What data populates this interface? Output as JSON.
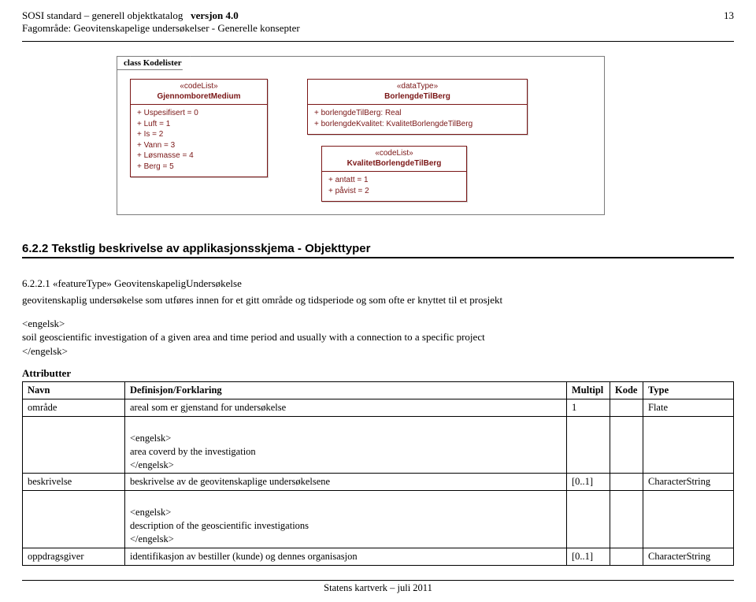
{
  "header": {
    "title_left": "SOSI standard – generell objektkatalog",
    "version_label": "versjon 4.0",
    "page_number": "13",
    "subtitle": "Fagområde: Geovitenskapelige undersøkelser -  Generelle konsepter"
  },
  "diagram": {
    "title": "class Kodelister",
    "box1": {
      "stereo": "«codeList»",
      "name": "GjennomboretMedium",
      "attrs": [
        "+    Uspesifisert = 0",
        "+    Luft = 1",
        "+    Is = 2",
        "+    Vann = 3",
        "+    Løsmasse = 4",
        "+    Berg = 5"
      ]
    },
    "box2": {
      "stereo": "«dataType»",
      "name": "BorlengdeTilBerg",
      "attrs": [
        "+    borlengdeTilBerg:  Real",
        "+    borlengdeKvalitet:  KvalitetBorlengdeTilBerg"
      ]
    },
    "box3": {
      "stereo": "«codeList»",
      "name": "KvalitetBorlengdeTilBerg",
      "attrs": [
        "+    antatt = 1",
        "+    påvist = 2"
      ]
    }
  },
  "section": {
    "heading": "6.2.2 Tekstlig beskrivelse av applikasjonsskjema - Objekttyper",
    "sub_number": "6.2.2.1",
    "sub_title": "«featureType» GeovitenskapeligUndersøkelse",
    "para_no": "geovitenskaplig undersøkelse som utføres innen for et gitt område og tidsperiode og som ofte er knyttet til et prosjekt",
    "engelsk_open": "<engelsk>",
    "para_en": "soil geoscientific investigation of a given area and time period and usually with a connection to a specific project",
    "engelsk_close": "</engelsk>",
    "attributter": "Attributter"
  },
  "table": {
    "headers": {
      "navn": "Navn",
      "def": "Definisjon/Forklaring",
      "mult": "Multipl",
      "kode": "Kode",
      "type": "Type"
    },
    "rows": [
      {
        "navn": "område",
        "def": "areal som er gjenstand for undersøkelse",
        "mult": "1",
        "kode": "",
        "type": "Flate",
        "extra": "<engelsk>\narea coverd by the investigation\n</engelsk>"
      },
      {
        "navn": "beskrivelse",
        "def": "beskrivelse av de geovitenskaplige undersøkelsene",
        "mult": "[0..1]",
        "kode": "",
        "type": "CharacterString",
        "extra": "<engelsk>\ndescription of the geoscientific investigations\n</engelsk>"
      },
      {
        "navn": "oppdragsgiver",
        "def": "identifikasjon av bestiller (kunde) og dennes organisasjon",
        "mult": "[0..1]",
        "kode": "",
        "type": "CharacterString",
        "extra": ""
      }
    ]
  },
  "footer": "Statens kartverk – juli 2011"
}
